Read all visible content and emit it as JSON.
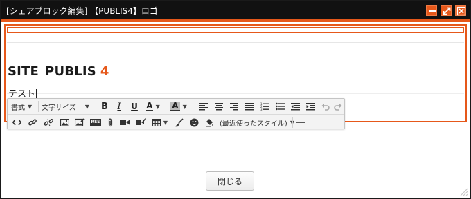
{
  "dialog": {
    "title": "[シェアブロック編集] 【PUBLIS4】ロゴ",
    "controls": [
      "minimize-icon",
      "maximize-icon",
      "close-icon"
    ],
    "accent_color": "#e6581a"
  },
  "content": {
    "logo_word1": "SITE",
    "logo_word2": "PUBLIS",
    "logo_number": "4",
    "body_text": "テスト"
  },
  "toolbar": {
    "format_label": "書式",
    "font_size_label": "文字サイズ",
    "recent_styles_label": "(最近使ったスタイル)",
    "row1_icons": [
      "bold-icon",
      "italic-icon",
      "underline-icon",
      "text-color-icon",
      "background-color-icon",
      "align-left-icon",
      "align-center-icon",
      "align-right-icon",
      "align-justify-icon",
      "numbered-list-icon",
      "bulleted-list-icon",
      "outdent-icon",
      "indent-icon",
      "undo-icon",
      "redo-icon"
    ],
    "row2_icons": [
      "source-code-icon",
      "link-icon",
      "unlink-icon",
      "image-icon",
      "image-edit-icon",
      "rss-icon",
      "attachment-icon",
      "video-icon",
      "video-edit-icon",
      "table-icon",
      "clear-format-icon",
      "emoji-icon",
      "paint-icon",
      "horizontal-rule-icon"
    ],
    "glyphs": {
      "bold": "B",
      "italic": "I",
      "underline": "U",
      "text_color": "A",
      "background_color": "A",
      "rss": "RSS"
    }
  },
  "footer": {
    "close_label": "閉じる"
  }
}
